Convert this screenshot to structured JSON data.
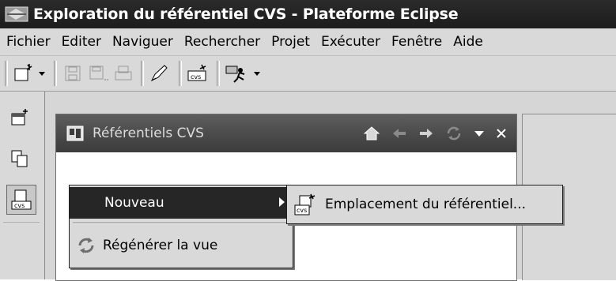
{
  "window": {
    "title": "Exploration du référentiel CVS - Plateforme Eclipse"
  },
  "menubar": {
    "items": [
      "Fichier",
      "Editer",
      "Naviguer",
      "Rechercher",
      "Projet",
      "Exécuter",
      "Fenêtre",
      "Aide"
    ]
  },
  "toolbar": {
    "icons": [
      "new-wizard-icon",
      "dropdown-arrow-icon",
      "save-icon",
      "save-all-icon",
      "print-icon",
      "pen-icon",
      "cvs-icon",
      "run-icon",
      "dropdown-arrow-icon"
    ]
  },
  "view": {
    "title": "Référentiels CVS"
  },
  "context_menu": {
    "new_label": "Nouveau",
    "refresh_label": "Régénérer la vue"
  },
  "submenu": {
    "location_label": "Emplacement du référentiel..."
  },
  "colors": {
    "titlebar": "#1c1c1c",
    "menu_highlight": "#262626",
    "chrome": "#d9d9d9"
  }
}
